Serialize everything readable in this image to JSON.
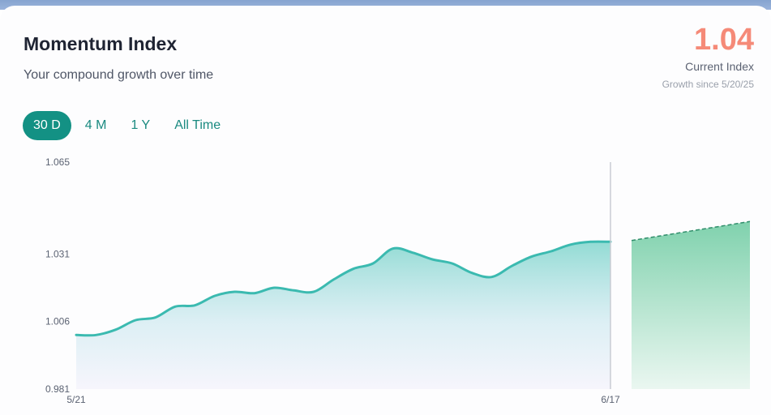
{
  "header": {
    "title": "Momentum Index",
    "subtitle": "Your compound growth over time"
  },
  "summary": {
    "value": "1.04",
    "label": "Current Index",
    "growth_since": "Growth since 5/20/25"
  },
  "range_tabs": [
    {
      "label": "30 D",
      "active": true
    },
    {
      "label": "4 M",
      "active": false
    },
    {
      "label": "1 Y",
      "active": false
    },
    {
      "label": "All Time",
      "active": false
    }
  ],
  "colors": {
    "accent": "#139184",
    "line": "#3bbab0",
    "index_value": "#f58a78",
    "projection": "#6fc9a4"
  },
  "chart_data": {
    "type": "area",
    "title": "",
    "xlabel": "",
    "ylabel": "",
    "ylim": [
      0.981,
      1.065
    ],
    "ytick_labels": [
      "1.065",
      "1.031",
      "1.006",
      "0.981"
    ],
    "ytick_values": [
      1.065,
      1.031,
      1.006,
      0.981
    ],
    "xtick_labels": [
      "5/21",
      "6/17"
    ],
    "x_start": "5/21",
    "x_end": "6/17",
    "grid": false,
    "legend": "none",
    "series": [
      {
        "values": [
          1.001,
          1.001,
          1.003,
          1.0065,
          1.0075,
          1.0115,
          1.012,
          1.0155,
          1.017,
          1.0165,
          1.0185,
          1.0175,
          1.017,
          1.0215,
          1.0255,
          1.0275,
          1.033,
          1.0315,
          1.029,
          1.0275,
          1.024,
          1.0225,
          1.0265,
          1.03,
          1.032,
          1.0345,
          1.0355,
          1.0355
        ]
      },
      {
        "type": "projection",
        "values": [
          1.036,
          1.043
        ]
      }
    ]
  }
}
